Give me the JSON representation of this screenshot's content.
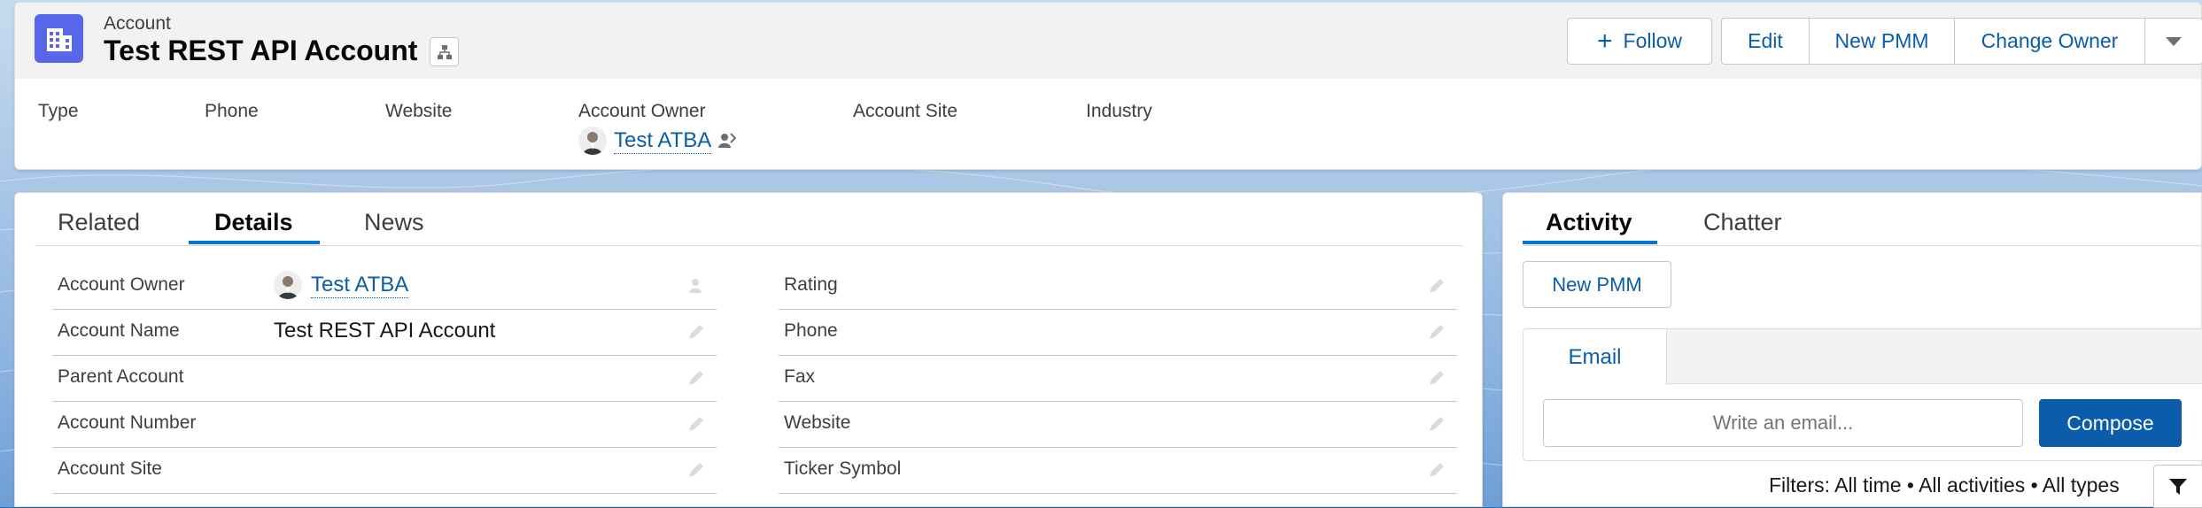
{
  "header": {
    "object_label": "Account",
    "title": "Test REST API Account",
    "actions": {
      "follow": "Follow",
      "edit": "Edit",
      "new_pmm": "New PMM",
      "change_owner": "Change Owner"
    },
    "highlights": {
      "type_label": "Type",
      "phone_label": "Phone",
      "website_label": "Website",
      "owner_label": "Account Owner",
      "site_label": "Account Site",
      "industry_label": "Industry",
      "owner_value": "Test ATBA"
    }
  },
  "details": {
    "tabs": [
      "Related",
      "Details",
      "News"
    ],
    "active_tab": "Details",
    "left_fields": [
      {
        "label": "Account Owner",
        "value": "Test ATBA"
      },
      {
        "label": "Account Name",
        "value": "Test REST API Account"
      },
      {
        "label": "Parent Account",
        "value": ""
      },
      {
        "label": "Account Number",
        "value": ""
      },
      {
        "label": "Account Site",
        "value": ""
      }
    ],
    "right_fields": [
      {
        "label": "Rating",
        "value": ""
      },
      {
        "label": "Phone",
        "value": ""
      },
      {
        "label": "Fax",
        "value": ""
      },
      {
        "label": "Website",
        "value": ""
      },
      {
        "label": "Ticker Symbol",
        "value": ""
      }
    ]
  },
  "activity": {
    "tabs": [
      "Activity",
      "Chatter"
    ],
    "active_tab": "Activity",
    "new_pmm": "New PMM",
    "email_tab": "Email",
    "email_placeholder": "Write an email...",
    "compose": "Compose",
    "filters": "Filters: All time • All activities • All types"
  },
  "colors": {
    "brand": "#0b5cab",
    "accent_tab": "#0176d3",
    "record_icon": "#5867e8"
  },
  "icons": [
    "account-building-icon",
    "hierarchy-icon",
    "plus-icon",
    "chevron-down-icon",
    "change-owner-icon",
    "pencil-icon",
    "filter-icon"
  ]
}
